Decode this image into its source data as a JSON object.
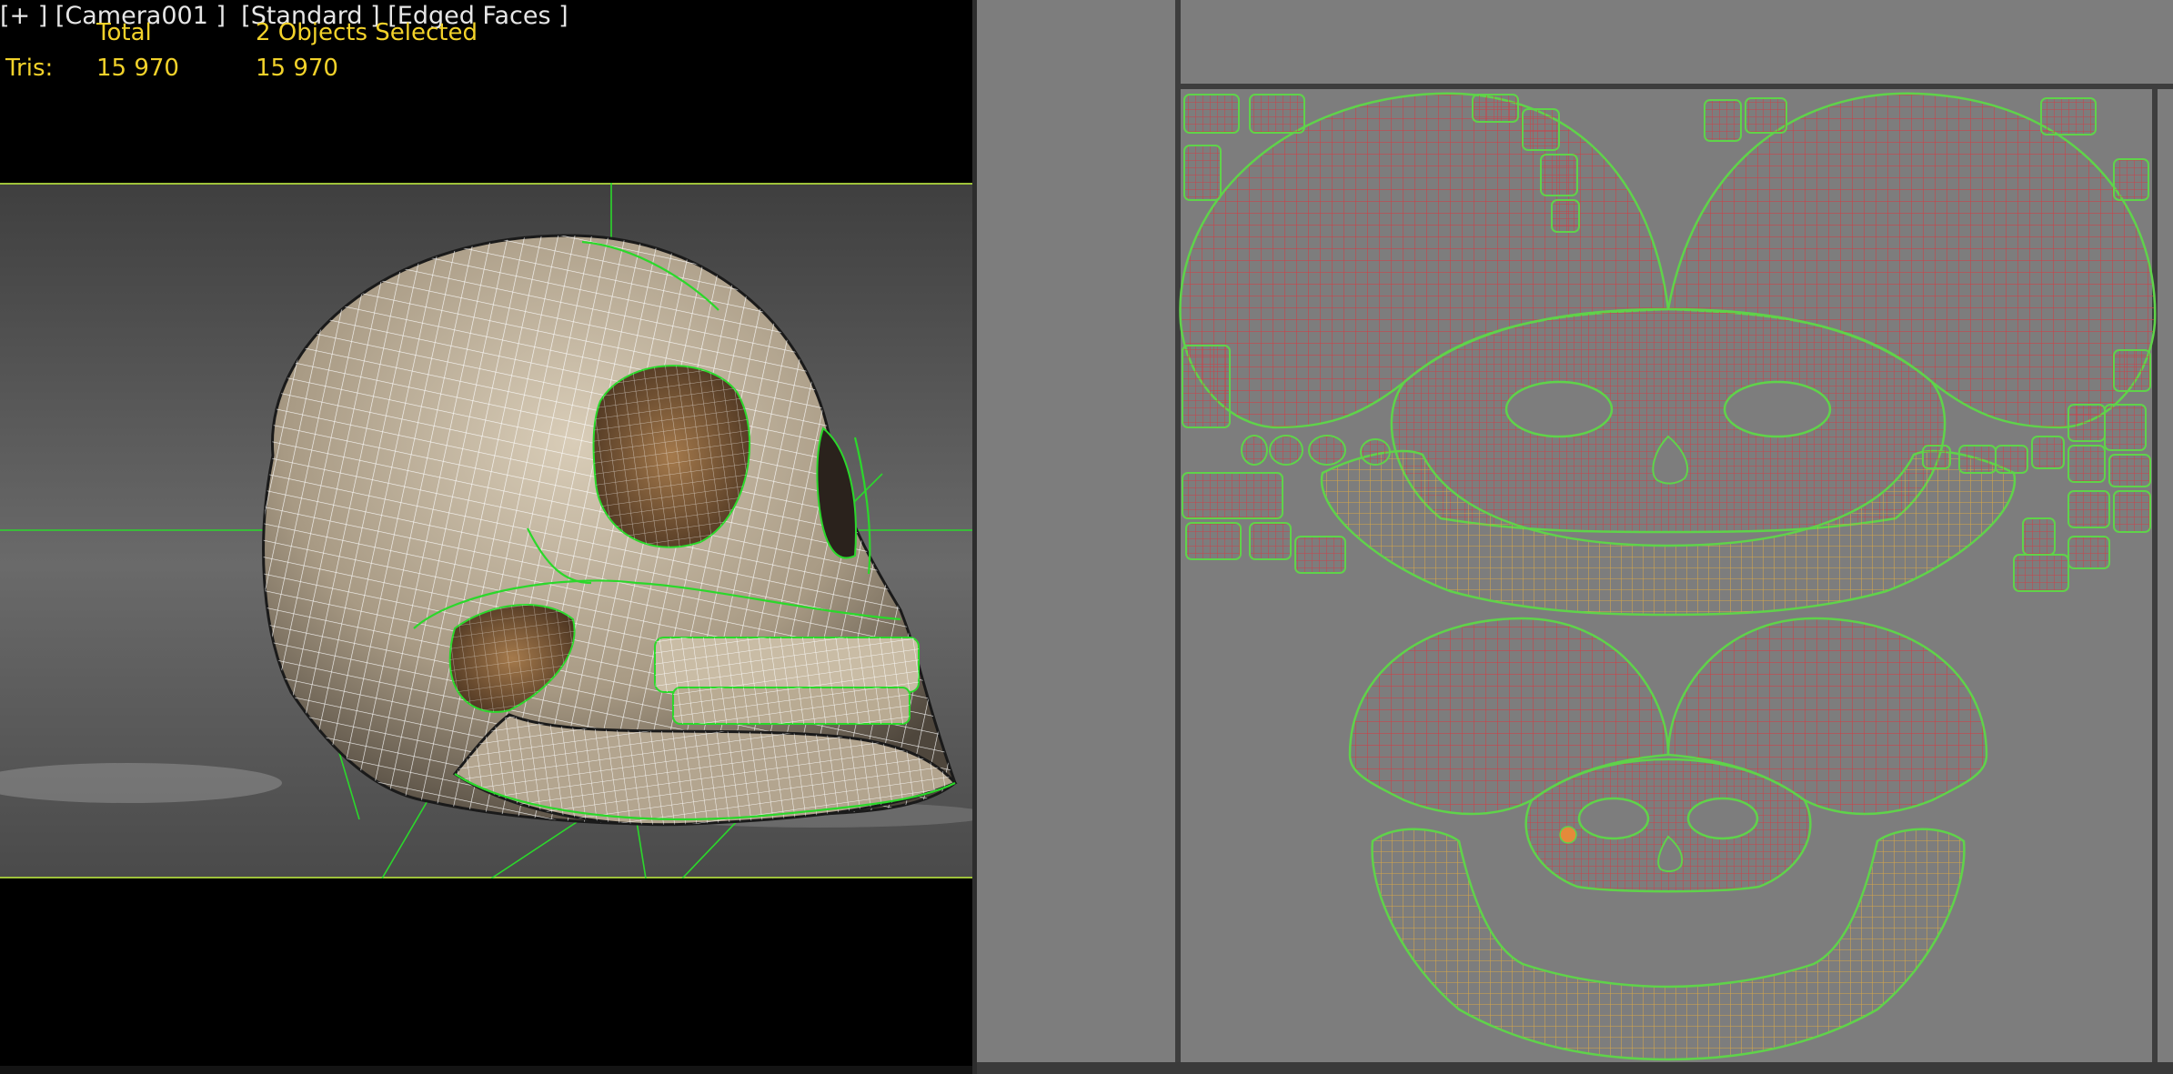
{
  "viewport": {
    "label": "[+ ] [Camera001 ]  [Standard ] [Edged Faces ]",
    "stats": {
      "col_total": "Total",
      "col_selected": "2 Objects Selected",
      "row_label": "Tris:",
      "tris_total": "15 970",
      "tris_selected": "15 970"
    }
  },
  "colors": {
    "stats_text": "#f2d22a",
    "uv_background": "#7d7d7d",
    "uv_border_green": "#5fd34a",
    "uv_mesh_red": "#c8444a",
    "uv_mesh_yellow": "#d6a648",
    "wire_white": "#ffffff",
    "wire_green": "#2bd82b"
  }
}
